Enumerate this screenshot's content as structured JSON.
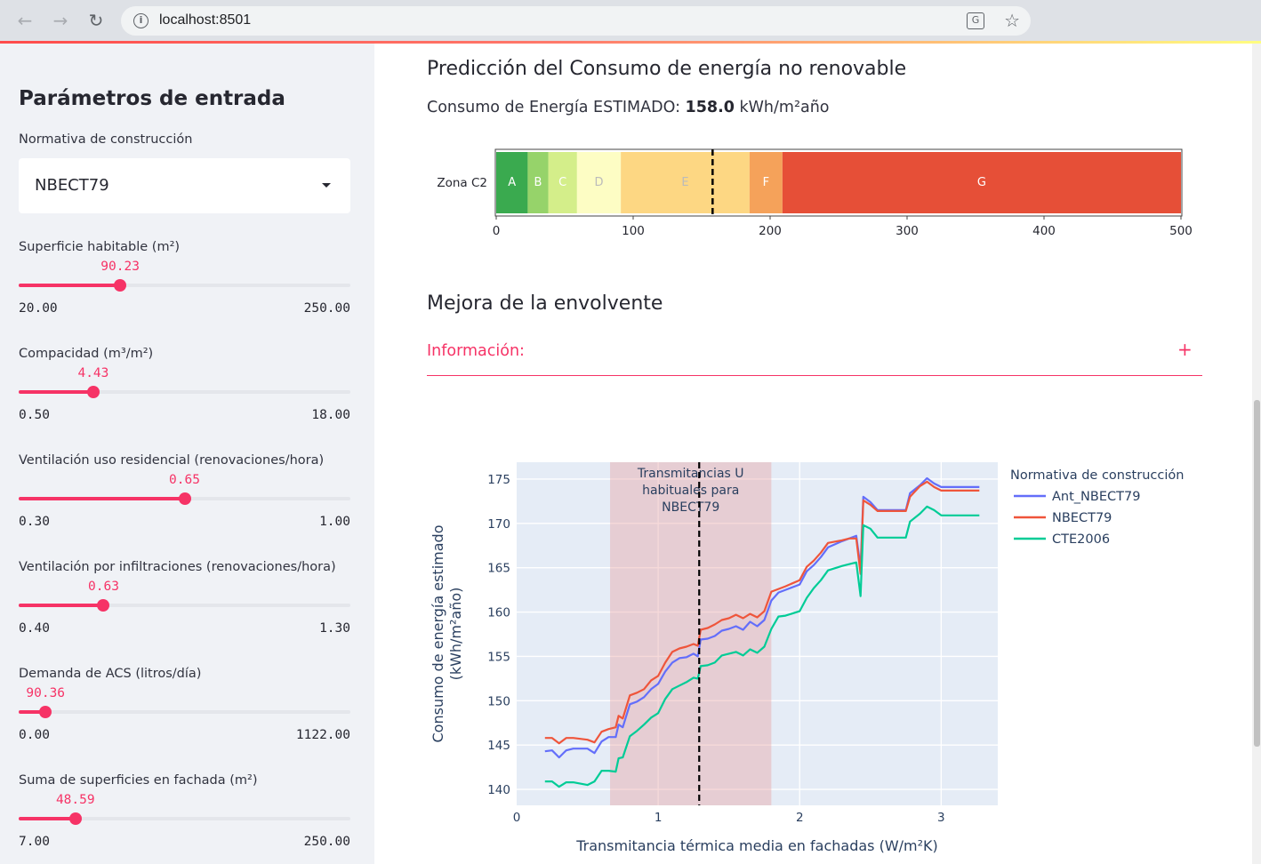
{
  "browser": {
    "back_icon": "←",
    "forward_icon": "→",
    "reload_icon": "↻",
    "info_icon": "i",
    "url": "localhost:8501",
    "translate_icon": "G",
    "star_icon": "☆"
  },
  "sidebar": {
    "title": "Parámetros de entrada",
    "normativa_label": "Normativa de construcción",
    "normativa_value": "NBECT79",
    "sliders": [
      {
        "label": "Superficie habitable (m²)",
        "value": "90.23",
        "min": "20.00",
        "max": "250.00",
        "fraction": 0.306
      },
      {
        "label": "Compacidad (m³/m²)",
        "value": "4.43",
        "min": "0.50",
        "max": "18.00",
        "fraction": 0.225
      },
      {
        "label": "Ventilación uso residencial (renovaciones/hora)",
        "value": "0.65",
        "min": "0.30",
        "max": "1.00",
        "fraction": 0.5
      },
      {
        "label": "Ventilación por infiltraciones (renovaciones/hora)",
        "value": "0.63",
        "min": "0.40",
        "max": "1.30",
        "fraction": 0.256
      },
      {
        "label": "Demanda de ACS (litros/día)",
        "value": "90.36",
        "min": "0.00",
        "max": "1122.00",
        "fraction": 0.081
      },
      {
        "label": "Suma de superficies en fachada (m²)",
        "value": "48.59",
        "min": "7.00",
        "max": "250.00",
        "fraction": 0.171
      }
    ]
  },
  "main": {
    "prediction_title": "Predicción del Consumo de energía no renovable",
    "estimate_prefix": "Consumo de Energía ESTIMADO:",
    "estimate_value": "158.0",
    "estimate_unit": "kWh/m²año",
    "improvement_title": "Mejora de la envolvente",
    "info_label": "Información:",
    "info_toggle": "+"
  },
  "chart_data": [
    {
      "type": "bar",
      "orientation": "horizontal-stacked",
      "category": "Zona C2",
      "segments": [
        {
          "label": "A",
          "from": 0,
          "to": 23,
          "color": "#3aaa4f"
        },
        {
          "label": "B",
          "from": 23,
          "to": 38,
          "color": "#96d36a"
        },
        {
          "label": "C",
          "from": 38,
          "to": 59,
          "color": "#d4ee8a"
        },
        {
          "label": "D",
          "from": 59,
          "to": 91,
          "color": "#fdfdc4"
        },
        {
          "label": "E",
          "from": 91,
          "to": 185,
          "color": "#fdd783"
        },
        {
          "label": "F",
          "from": 185,
          "to": 209,
          "color": "#f5a25a"
        },
        {
          "label": "G",
          "from": 209,
          "to": 500,
          "color": "#e64f37"
        }
      ],
      "marker": 158.0,
      "xlim": [
        0,
        500
      ],
      "xticks": [
        "0",
        "100",
        "200",
        "300",
        "400",
        "500"
      ]
    },
    {
      "type": "line",
      "xlabel": "Transmitancia térmica media en fachadas (W/m²K)",
      "ylabel": "Consumo de energía estimado (kWh/m²año)",
      "ylabel_lines": [
        "Consumo de energía estimado",
        "(kWh/m²año)"
      ],
      "xlim": [
        0,
        3.4
      ],
      "ylim": [
        138.2,
        176.9
      ],
      "xticks": [
        "0",
        "1",
        "2",
        "3"
      ],
      "yticks": [
        "140",
        "145",
        "150",
        "155",
        "160",
        "165",
        "170",
        "175"
      ],
      "band": {
        "from": 0.66,
        "to": 1.8,
        "label_lines": [
          "Transmitancias U",
          "habituales para",
          "NBECT79"
        ]
      },
      "vline": 1.29,
      "legend_title": "Normativa de construcción",
      "legend_position": "right",
      "series": [
        {
          "name": "Ant_NBECT79",
          "color": "#636efa",
          "points": [
            [
              0.2,
              144.3
            ],
            [
              0.25,
              144.4
            ],
            [
              0.3,
              143.6
            ],
            [
              0.35,
              144.4
            ],
            [
              0.4,
              144.6
            ],
            [
              0.5,
              144.6
            ],
            [
              0.55,
              144.1
            ],
            [
              0.6,
              145.4
            ],
            [
              0.65,
              145.9
            ],
            [
              0.7,
              145.9
            ],
            [
              0.72,
              147.3
            ],
            [
              0.75,
              147.0
            ],
            [
              0.8,
              149.6
            ],
            [
              0.85,
              149.9
            ],
            [
              0.9,
              150.4
            ],
            [
              0.95,
              151.3
            ],
            [
              1.0,
              151.9
            ],
            [
              1.05,
              153.3
            ],
            [
              1.1,
              154.3
            ],
            [
              1.15,
              154.8
            ],
            [
              1.2,
              154.9
            ],
            [
              1.25,
              155.3
            ],
            [
              1.28,
              155.0
            ],
            [
              1.3,
              156.9
            ],
            [
              1.35,
              157.0
            ],
            [
              1.4,
              157.3
            ],
            [
              1.45,
              157.9
            ],
            [
              1.5,
              158.1
            ],
            [
              1.55,
              158.4
            ],
            [
              1.6,
              158.0
            ],
            [
              1.65,
              158.9
            ],
            [
              1.7,
              158.4
            ],
            [
              1.75,
              159.1
            ],
            [
              1.8,
              161.3
            ],
            [
              1.85,
              162.2
            ],
            [
              1.9,
              162.5
            ],
            [
              2.0,
              163.1
            ],
            [
              2.05,
              164.6
            ],
            [
              2.1,
              165.3
            ],
            [
              2.15,
              166.2
            ],
            [
              2.2,
              167.3
            ],
            [
              2.3,
              168.0
            ],
            [
              2.35,
              168.3
            ],
            [
              2.4,
              168.6
            ],
            [
              2.43,
              165.0
            ],
            [
              2.45,
              173.0
            ],
            [
              2.5,
              172.4
            ],
            [
              2.55,
              171.5
            ],
            [
              2.75,
              171.5
            ],
            [
              2.78,
              173.4
            ],
            [
              2.85,
              174.3
            ],
            [
              2.9,
              175.1
            ],
            [
              2.95,
              174.5
            ],
            [
              3.0,
              174.1
            ],
            [
              3.27,
              174.1
            ]
          ]
        },
        {
          "name": "NBECT79",
          "color": "#ef553b",
          "points": [
            [
              0.2,
              145.8
            ],
            [
              0.25,
              145.8
            ],
            [
              0.3,
              145.2
            ],
            [
              0.35,
              145.8
            ],
            [
              0.4,
              145.8
            ],
            [
              0.5,
              145.6
            ],
            [
              0.55,
              145.3
            ],
            [
              0.6,
              146.5
            ],
            [
              0.65,
              146.8
            ],
            [
              0.7,
              147.0
            ],
            [
              0.72,
              148.3
            ],
            [
              0.75,
              148.0
            ],
            [
              0.8,
              150.6
            ],
            [
              0.85,
              150.9
            ],
            [
              0.9,
              151.3
            ],
            [
              0.95,
              152.3
            ],
            [
              1.0,
              152.8
            ],
            [
              1.05,
              154.3
            ],
            [
              1.1,
              155.5
            ],
            [
              1.15,
              155.9
            ],
            [
              1.2,
              156.1
            ],
            [
              1.25,
              156.4
            ],
            [
              1.28,
              156.2
            ],
            [
              1.3,
              158.0
            ],
            [
              1.35,
              158.2
            ],
            [
              1.4,
              158.6
            ],
            [
              1.45,
              159.1
            ],
            [
              1.5,
              159.3
            ],
            [
              1.55,
              159.7
            ],
            [
              1.6,
              159.3
            ],
            [
              1.65,
              159.8
            ],
            [
              1.7,
              159.4
            ],
            [
              1.75,
              160.1
            ],
            [
              1.8,
              162.3
            ],
            [
              1.85,
              162.6
            ],
            [
              1.9,
              162.9
            ],
            [
              2.0,
              163.6
            ],
            [
              2.05,
              165.1
            ],
            [
              2.1,
              165.8
            ],
            [
              2.15,
              166.7
            ],
            [
              2.2,
              167.8
            ],
            [
              2.3,
              168.1
            ],
            [
              2.35,
              168.3
            ],
            [
              2.4,
              168.3
            ],
            [
              2.43,
              164.3
            ],
            [
              2.45,
              172.6
            ],
            [
              2.5,
              172.1
            ],
            [
              2.55,
              171.4
            ],
            [
              2.75,
              171.4
            ],
            [
              2.78,
              173.0
            ],
            [
              2.85,
              174.2
            ],
            [
              2.9,
              174.7
            ],
            [
              2.95,
              174.1
            ],
            [
              3.0,
              173.7
            ],
            [
              3.27,
              173.7
            ]
          ]
        },
        {
          "name": "CTE2006",
          "color": "#00cc96",
          "points": [
            [
              0.2,
              140.9
            ],
            [
              0.25,
              140.9
            ],
            [
              0.3,
              140.3
            ],
            [
              0.35,
              140.8
            ],
            [
              0.4,
              140.8
            ],
            [
              0.5,
              140.5
            ],
            [
              0.55,
              140.9
            ],
            [
              0.6,
              142.1
            ],
            [
              0.65,
              142.1
            ],
            [
              0.7,
              142.0
            ],
            [
              0.72,
              143.5
            ],
            [
              0.75,
              143.6
            ],
            [
              0.8,
              146.0
            ],
            [
              0.85,
              146.6
            ],
            [
              0.9,
              147.3
            ],
            [
              0.95,
              148.1
            ],
            [
              1.0,
              148.6
            ],
            [
              1.05,
              150.2
            ],
            [
              1.1,
              151.3
            ],
            [
              1.15,
              151.7
            ],
            [
              1.2,
              152.1
            ],
            [
              1.25,
              152.6
            ],
            [
              1.28,
              152.5
            ],
            [
              1.3,
              153.9
            ],
            [
              1.35,
              154.0
            ],
            [
              1.4,
              154.3
            ],
            [
              1.45,
              155.1
            ],
            [
              1.5,
              155.3
            ],
            [
              1.55,
              155.5
            ],
            [
              1.6,
              155.1
            ],
            [
              1.65,
              155.8
            ],
            [
              1.7,
              155.4
            ],
            [
              1.75,
              156.1
            ],
            [
              1.8,
              158.1
            ],
            [
              1.85,
              159.5
            ],
            [
              1.9,
              159.6
            ],
            [
              2.0,
              160.1
            ],
            [
              2.05,
              161.6
            ],
            [
              2.1,
              162.7
            ],
            [
              2.15,
              163.6
            ],
            [
              2.2,
              164.7
            ],
            [
              2.3,
              165.2
            ],
            [
              2.35,
              165.4
            ],
            [
              2.4,
              165.6
            ],
            [
              2.43,
              161.8
            ],
            [
              2.45,
              169.8
            ],
            [
              2.5,
              169.4
            ],
            [
              2.55,
              168.4
            ],
            [
              2.75,
              168.4
            ],
            [
              2.78,
              170.2
            ],
            [
              2.85,
              171.1
            ],
            [
              2.9,
              171.9
            ],
            [
              2.95,
              171.5
            ],
            [
              3.0,
              170.9
            ],
            [
              3.27,
              170.9
            ]
          ]
        }
      ]
    }
  ]
}
